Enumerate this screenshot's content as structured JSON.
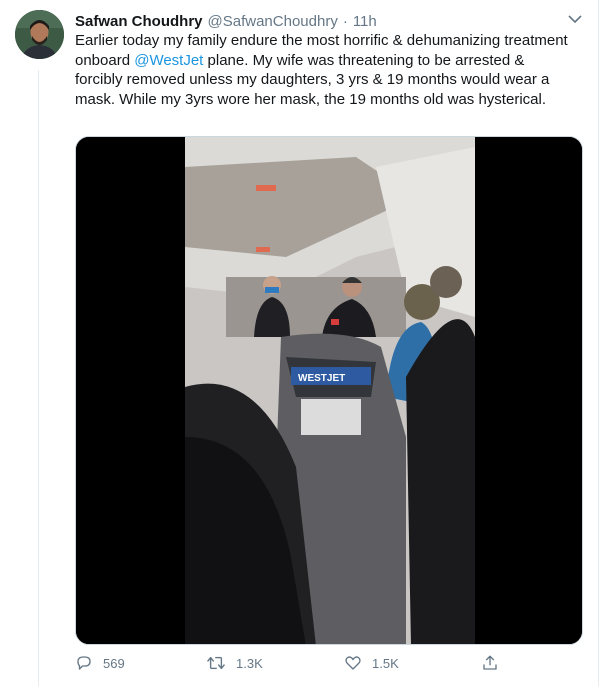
{
  "tweet": {
    "author_name": "Safwan Choudhry",
    "author_handle": "@SafwanChoudhry",
    "separator": "·",
    "time": "11h",
    "text_before_mention": "Earlier today my family endure the most horrific & dehumanizing treatment onboard ",
    "mention": "@WestJet",
    "text_after_mention": " plane. My wife was threatening to be arrested & forcibly removed unless my daughters, 3 yrs & 19 months would wear a mask. While my 3yrs wore her mask, the 19 months old was hysterical.",
    "media": {
      "seatback_logo": "WESTJET"
    }
  },
  "actions": {
    "reply_count": "569",
    "retweet_count": "1.3K",
    "like_count": "1.5K"
  },
  "icons": {
    "caret": "chevron-down-icon",
    "reply": "reply-icon",
    "retweet": "retweet-icon",
    "like": "heart-icon",
    "share": "share-icon"
  },
  "colors": {
    "text": "#14171a",
    "secondary": "#657786",
    "link": "#1b95e0",
    "divider": "#e6ecf0"
  }
}
